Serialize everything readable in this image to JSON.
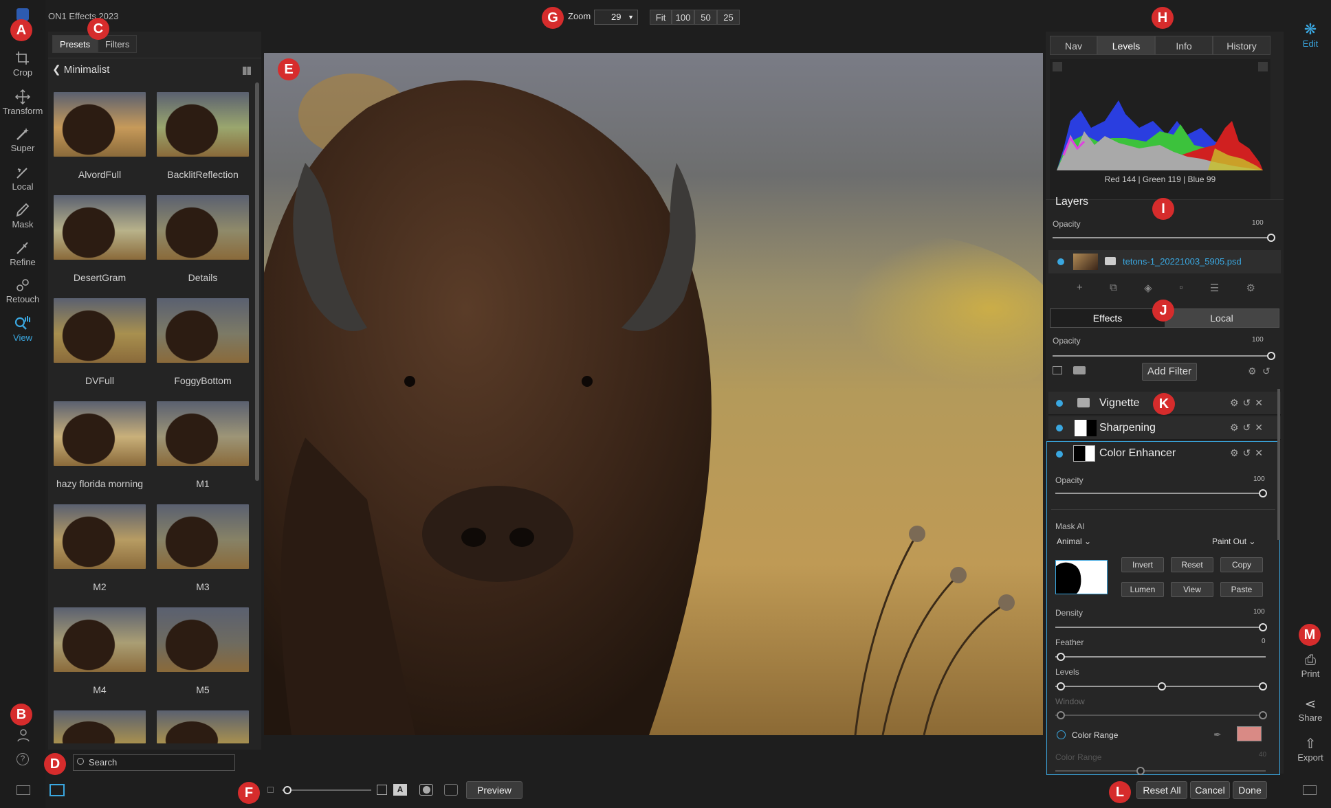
{
  "app": {
    "title": "ON1 Effects 2023"
  },
  "toolbar": {
    "tools": [
      {
        "label": "Crop",
        "icon": "crop-icon"
      },
      {
        "label": "Transform",
        "icon": "transform-icon"
      },
      {
        "label": "Super",
        "icon": "super-select-icon"
      },
      {
        "label": "Local",
        "icon": "local-adjust-icon"
      },
      {
        "label": "Mask",
        "icon": "mask-brush-icon"
      },
      {
        "label": "Refine",
        "icon": "refine-icon"
      },
      {
        "label": "Retouch",
        "icon": "retouch-icon"
      },
      {
        "label": "View",
        "icon": "view-hand-icon"
      }
    ]
  },
  "browser": {
    "tabs": [
      "Presets",
      "Filters"
    ],
    "category": "Minimalist",
    "search_placeholder": "Search",
    "presets": [
      "AlvordFull",
      "BacklitReflection",
      "DesertGram",
      "Details",
      "DVFull",
      "FoggyBottom",
      "hazy florida morning",
      "M1",
      "M2",
      "M3",
      "M4",
      "M5"
    ]
  },
  "zoom": {
    "label": "Zoom",
    "value": "29",
    "presets": [
      "Fit",
      "100",
      "50",
      "25"
    ]
  },
  "right": {
    "tabs": [
      "Nav",
      "Levels",
      "Info",
      "History"
    ],
    "active_tab": "Levels",
    "readout": "Red 144 | Green 119 | Blue  99",
    "layers_title": "Layers",
    "opacity_label": "Opacity",
    "opacity_value": "100",
    "layer_name": "tetons-1_20221003_5905.psd",
    "mode_tabs": [
      "Effects",
      "Local"
    ],
    "effects_opacity_label": "Opacity",
    "effects_opacity_value": "100",
    "add_filter": "Add Filter",
    "filters": [
      "Vignette",
      "Sharpening",
      "Color Enhancer"
    ],
    "ce": {
      "opacity_label": "Opacity",
      "opacity_value": "100",
      "mask_ai": "Mask AI",
      "mask_type": "Animal",
      "paint_mode": "Paint Out",
      "buttons": [
        "Invert",
        "Reset",
        "Copy",
        "Lumen",
        "View",
        "Paste"
      ],
      "density_label": "Density",
      "density_value": "100",
      "feather_label": "Feather",
      "feather_value": "0",
      "levels_label": "Levels",
      "window_label": "Window",
      "color_range_label": "Color Range",
      "color_range_sub": "Color Range",
      "color_range_value": "40",
      "swatch": "#d98a85"
    }
  },
  "right_tools": [
    {
      "label": "Edit",
      "icon": "edit-gear-icon"
    },
    {
      "label": "Print",
      "icon": "print-icon"
    },
    {
      "label": "Share",
      "icon": "share-icon"
    },
    {
      "label": "Export",
      "icon": "export-icon"
    }
  ],
  "bottom": {
    "preview": "Preview",
    "reset_all": "Reset All",
    "cancel": "Cancel",
    "done": "Done"
  },
  "callouts": [
    "A",
    "B",
    "C",
    "D",
    "E",
    "F",
    "G",
    "H",
    "I",
    "J",
    "K",
    "L",
    "M"
  ],
  "colors": {
    "accent": "#3aa7e0",
    "callout": "#d62c2c"
  }
}
